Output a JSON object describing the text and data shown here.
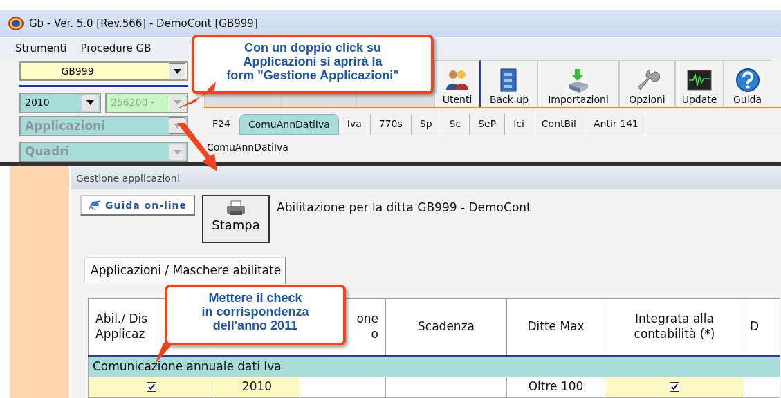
{
  "window": {
    "title": "Gb - Ver. 5.0 [Rev.566] -  DemoCont [GB999]"
  },
  "menu": [
    "Strumenti",
    "Procedure GB"
  ],
  "selectors": [
    {
      "value": "GB999",
      "kind": "company",
      "disabled": false
    },
    {
      "value": "2010",
      "kind": "year",
      "disabled": false
    },
    {
      "value": "256200 -",
      "kind": "code",
      "disabled": true
    },
    {
      "value": "Applicazioni",
      "kind": "section",
      "disabled": true
    },
    {
      "value": "Quadri",
      "kind": "section",
      "disabled": true
    }
  ],
  "toolbar": [
    {
      "label": "Utenti",
      "kind": "users"
    },
    {
      "label": "Back up",
      "kind": "cabinet"
    },
    {
      "label": "Importazioni",
      "kind": "import"
    },
    {
      "label": "Opzioni",
      "kind": "wrench"
    },
    {
      "label": "Update",
      "kind": "monitor"
    },
    {
      "label": "Guida",
      "kind": "help"
    }
  ],
  "tabs": [
    {
      "label": "F24",
      "selected": false
    },
    {
      "label": "ComuAnnDatiIva",
      "selected": true
    },
    {
      "label": "Iva",
      "selected": false
    },
    {
      "label": "770s",
      "selected": false
    },
    {
      "label": "Sp",
      "selected": false
    },
    {
      "label": "Sc",
      "selected": false
    },
    {
      "label": "SeP",
      "selected": false
    },
    {
      "label": "Ici",
      "selected": false
    },
    {
      "label": "ContBil",
      "selected": false
    },
    {
      "label": "Antir 141",
      "selected": false
    }
  ],
  "subtitle": "ComuAnnDatiIva",
  "form": {
    "title": "Gestione applicazioni",
    "help_button": "Guida on-line",
    "print_button": "Stampa",
    "company_label": "Abilitazione per la ditta GB999 -  DemoCont",
    "tabs": [
      {
        "label": "Applicazioni / Maschere abilitate",
        "selected": true
      }
    ]
  },
  "table": {
    "columns": [
      {
        "lines": [
          "Abil./ Dis",
          "Applicaz"
        ]
      },
      {
        "lines": [
          "one",
          "o"
        ]
      },
      {
        "lines": [
          "Scadenza"
        ]
      },
      {
        "lines": [
          "Ditte Max"
        ]
      },
      {
        "lines": [
          "Integrata alla",
          "contabilità (*)"
        ]
      },
      {
        "lines": [
          "D"
        ]
      }
    ],
    "groups": [
      {
        "title": "Comunicazione annuale dati Iva",
        "rows": [
          {
            "enabled": true,
            "year": "2010",
            "ditte_max": "Oltre 100",
            "integrated": true
          }
        ]
      }
    ]
  },
  "callouts": [
    {
      "lines": [
        "Con un doppio click su",
        "Applicazioni si aprirà la",
        "form \"Gestione Applicazioni\""
      ]
    },
    {
      "lines": [
        "Mettere il check",
        "in corrispondenza",
        "dell'anno 2011"
      ]
    }
  ]
}
